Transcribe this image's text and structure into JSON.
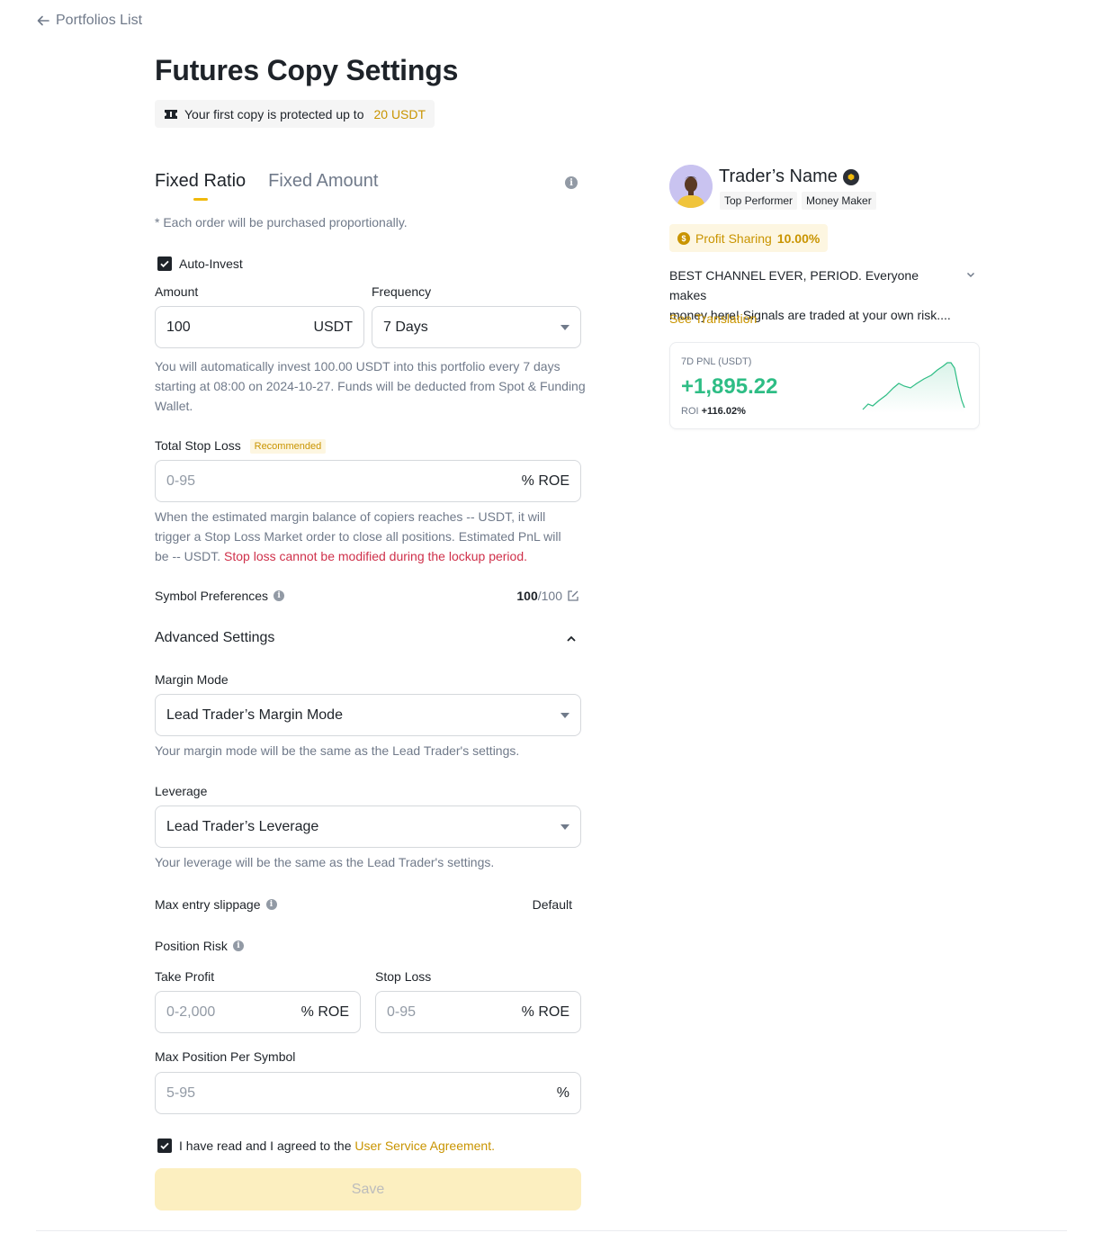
{
  "nav": {
    "back_label": "Portfolios List"
  },
  "page": {
    "title": "Futures Copy Settings"
  },
  "protection": {
    "text": "Your first copy is protected up to",
    "amount": "20 USDT"
  },
  "tabs": [
    {
      "label": "Fixed Ratio",
      "active": true
    },
    {
      "label": "Fixed Amount",
      "active": false
    }
  ],
  "tab_note": "*  Each order will be purchased proportionally.",
  "auto_invest": {
    "label": "Auto-Invest",
    "checked": true
  },
  "amount": {
    "label": "Amount",
    "value": "100",
    "unit": "USDT"
  },
  "frequency": {
    "label": "Frequency",
    "value": "7 Days"
  },
  "auto_invest_help_1": "You will automatically invest 100.00 USDT into this portfolio every 7 days",
  "auto_invest_help_2": "starting at 08:00 on 2024-10-27. Funds will be deducted from Spot & Funding",
  "auto_invest_help_3": "Wallet.",
  "total_stop_loss": {
    "label": "Total Stop Loss",
    "badge": "Recommended",
    "placeholder": "0-95",
    "unit": "% ROE",
    "help_1": "When the estimated margin balance of copiers reaches -- USDT, it will",
    "help_2": "trigger a Stop Loss Market order to close all positions. Estimated PnL will",
    "help_3": "be -- USDT.",
    "warning": "Stop loss cannot be modified during the lockup period."
  },
  "symbol_preferences": {
    "label": "Symbol Preferences",
    "selected": "100",
    "total": "/100"
  },
  "advanced": {
    "title": "Advanced Settings"
  },
  "margin_mode": {
    "label": "Margin Mode",
    "value": "Lead Trader’s Margin Mode",
    "help": "Your margin mode will be the same as the Lead Trader's settings."
  },
  "leverage": {
    "label": "Leverage",
    "value": "Lead Trader’s Leverage",
    "help": "Your leverage will be the same as the Lead Trader's settings."
  },
  "slippage": {
    "label": "Max entry slippage",
    "value": "Default"
  },
  "position_risk": {
    "label": "Position Risk"
  },
  "take_profit": {
    "label": "Take Profit",
    "placeholder": "0-2,000",
    "unit": "% ROE"
  },
  "stop_loss": {
    "label": "Stop Loss",
    "placeholder": "0-95",
    "unit": "% ROE"
  },
  "max_position": {
    "label": "Max Position Per Symbol",
    "placeholder": "5-95",
    "unit": "%"
  },
  "agreement": {
    "text": "I have read and I agreed to the",
    "link": "User Service Agreement.",
    "checked": true
  },
  "save_label": "Save",
  "trader": {
    "name": "Trader’s Name",
    "tags": [
      "Top Performer",
      "Money Maker"
    ],
    "profit_sharing_label": "Profit Sharing",
    "profit_sharing_value": "10.00%",
    "bio_1": "BEST CHANNEL EVER, PERIOD. Everyone makes",
    "bio_2": "money here! Signals are traded at your own risk....",
    "see_translation": "See Translation"
  },
  "pnl": {
    "label": "7D PNL (USDT)",
    "value": "+1,895.22",
    "roi_label": "ROI",
    "roi_value": "+116.02%"
  },
  "colors": {
    "accent": "#f0b90b",
    "accent_text": "#c99400",
    "positive": "#2ebd85",
    "warning": "#cf304a"
  }
}
